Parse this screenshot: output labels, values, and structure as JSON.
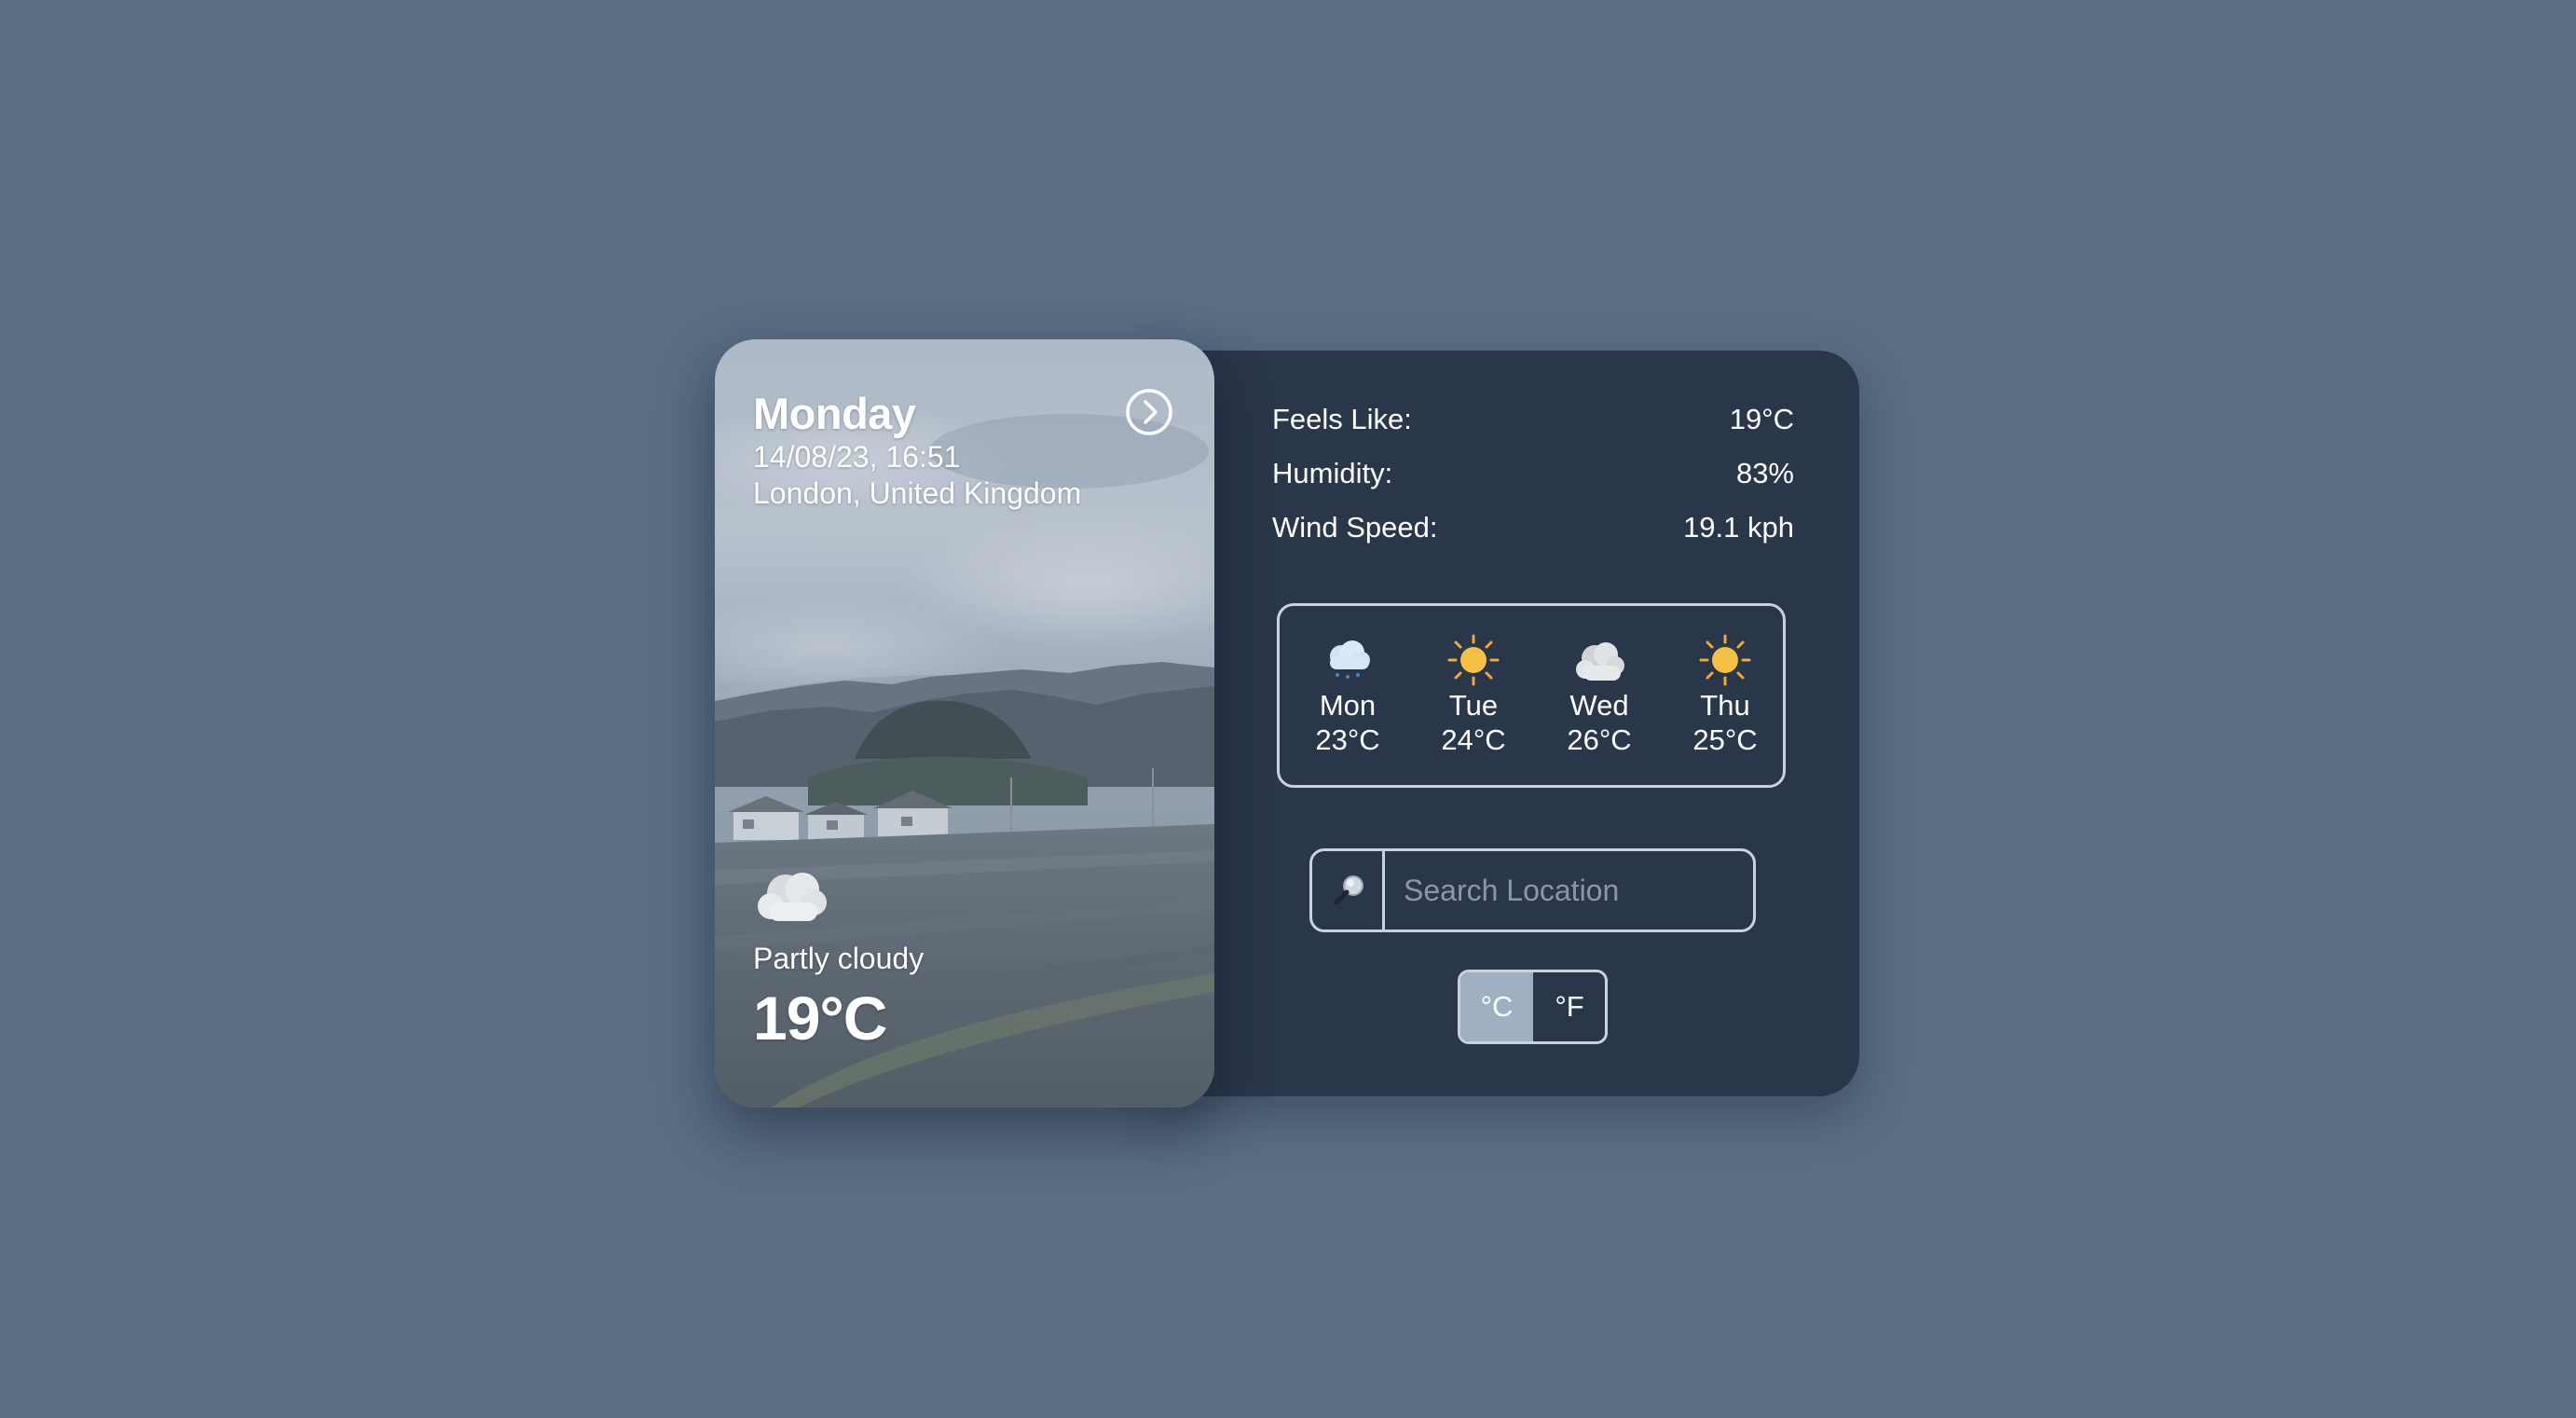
{
  "hero": {
    "day": "Monday",
    "datetime": "14/08/23, 16:51",
    "location": "London, United Kingdom",
    "condition": "Partly cloudy",
    "temperature": "19°C",
    "condition_icon": "partly-cloudy-icon",
    "next_icon": "chevron-right-circle-icon"
  },
  "details": [
    {
      "label": "Feels Like:",
      "value": "19°C"
    },
    {
      "label": "Humidity:",
      "value": "83%"
    },
    {
      "label": "Wind Speed:",
      "value": "19.1 kph"
    }
  ],
  "forecast": [
    {
      "day": "Mon",
      "temp": "23°C",
      "icon": "rain-cloud-icon"
    },
    {
      "day": "Tue",
      "temp": "24°C",
      "icon": "sun-icon"
    },
    {
      "day": "Wed",
      "temp": "26°C",
      "icon": "cloud-icon"
    },
    {
      "day": "Thu",
      "temp": "25°C",
      "icon": "sun-icon"
    }
  ],
  "search": {
    "placeholder": "Search Location",
    "icon": "magnifier-icon"
  },
  "units": {
    "celsius": "°C",
    "fahrenheit": "°F",
    "selected": "°C"
  },
  "colors": {
    "page_bg": "#5a6d83",
    "panel_bg": "#2a364a",
    "border": "#c9d3df",
    "active_unit": "#9fb0c2"
  }
}
